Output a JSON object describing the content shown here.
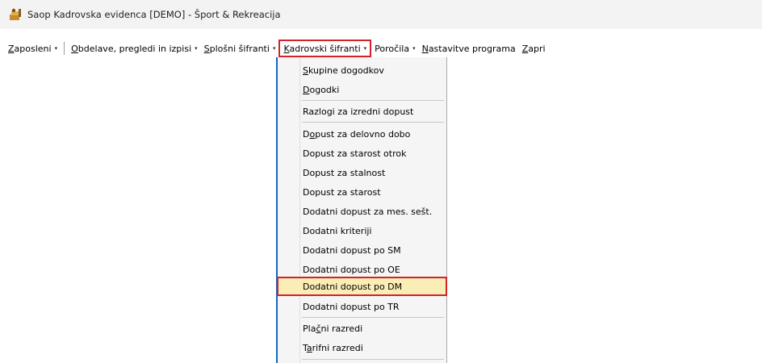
{
  "window": {
    "title": "Saop Kadrovska evidenca  [DEMO] - Šport & Rekreacija",
    "icon": "saop-app-icon"
  },
  "menubar": {
    "items": [
      {
        "pre": "",
        "mn": "Z",
        "post": "aposleni",
        "arrow": "▾",
        "active": false
      },
      {
        "pre": "",
        "mn": "O",
        "post": "bdelave, pregledi in izpisi",
        "arrow": "▾",
        "active": false
      },
      {
        "pre": "",
        "mn": "S",
        "post": "plošni šifranti",
        "arrow": "▾",
        "active": false
      },
      {
        "pre": "",
        "mn": "K",
        "post": "adrovski šifranti",
        "arrow": "▾",
        "active": true
      },
      {
        "pre": "",
        "mn": "",
        "post": "Poročila",
        "arrow": "▾",
        "active": false
      },
      {
        "pre": "",
        "mn": "N",
        "post": "astavitve programa",
        "arrow": "",
        "active": false
      },
      {
        "pre": "",
        "mn": "Z",
        "post": "apri",
        "arrow": "",
        "active": false
      }
    ]
  },
  "dropdown": {
    "items": [
      {
        "pre": "",
        "mn": "S",
        "post": "kupine dogodkov"
      },
      {
        "pre": "",
        "mn": "D",
        "post": "ogodki"
      },
      {
        "pre": "Razlogi za izredni dopust",
        "mn": "",
        "post": ""
      },
      {
        "pre": "D",
        "mn": "o",
        "post": "pust za delovno dobo"
      },
      {
        "pre": "Dopust za starost otrok",
        "mn": "",
        "post": ""
      },
      {
        "pre": "Dopust za stalnost",
        "mn": "",
        "post": ""
      },
      {
        "pre": "Dopust za starost",
        "mn": "",
        "post": ""
      },
      {
        "pre": "Dodatni dopust za mes. sešt.",
        "mn": "",
        "post": ""
      },
      {
        "pre": "Dodatni kriteriji",
        "mn": "",
        "post": ""
      },
      {
        "pre": "Dodatni dopust po SM",
        "mn": "",
        "post": ""
      },
      {
        "pre": "Dodatni dopust po OE",
        "mn": "",
        "post": ""
      },
      {
        "pre": "Dodatni dopust po DM",
        "mn": "",
        "post": "",
        "highlight": true
      },
      {
        "pre": "Dodatni dopust po TR",
        "mn": "",
        "post": ""
      },
      {
        "pre": "Pla",
        "mn": "č",
        "post": "ni razredi"
      },
      {
        "pre": "T",
        "mn": "a",
        "post": "rifni razredi"
      }
    ]
  },
  "colors": {
    "highlight_border": "#d2222d",
    "highlight_fill": "#fbedb6",
    "menu_accent": "#1565c0"
  }
}
